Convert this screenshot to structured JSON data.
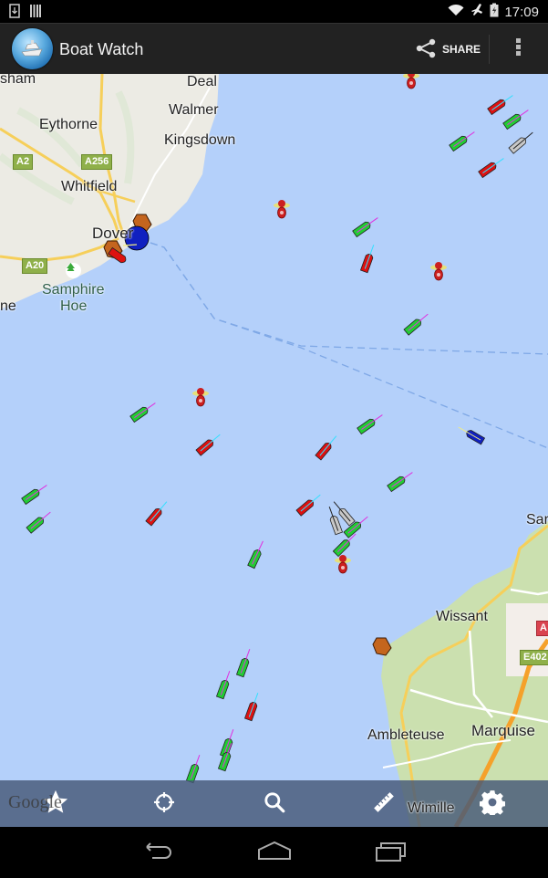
{
  "status_bar": {
    "left_icons": [
      "download-icon",
      "barcode-icon"
    ],
    "right_icons": [
      "wifi-icon",
      "airplane-mode-icon",
      "battery-charging-icon"
    ],
    "time": "17:09"
  },
  "action_bar": {
    "app_icon": "cruise-ship-logo-icon",
    "title": "Boat Watch",
    "share_label": "SHARE",
    "share_icon": "share-icon",
    "overflow_icon": "overflow-menu-icon"
  },
  "map": {
    "places": [
      {
        "name": "sham"
      },
      {
        "name": "Deal"
      },
      {
        "name": "Walmer"
      },
      {
        "name": "Eythorne"
      },
      {
        "name": "Kingsdown"
      },
      {
        "name": "Whitfield"
      },
      {
        "name": "Dover"
      },
      {
        "name": "Samphire"
      },
      {
        "name": "Hoe"
      },
      {
        "name": "ne"
      },
      {
        "name": "Sar"
      },
      {
        "name": "Wissant"
      },
      {
        "name": "Ambleteuse"
      },
      {
        "name": "Marquise"
      },
      {
        "name": "Wimille"
      }
    ],
    "road_labels": [
      "A2",
      "A256",
      "A20",
      "A",
      "E402"
    ],
    "poi_icon": "park-tree-icon",
    "vessel_legend": {
      "green": "#22cc33",
      "red": "#dd1111",
      "grey": "#c8c8c8",
      "blue": "#1020c0",
      "port": "#c4651e",
      "buoy": "#cc1f1f"
    },
    "attribution": "Google"
  },
  "bottom_toolbar": {
    "buttons": [
      {
        "name": "favorites",
        "icon": "star-icon"
      },
      {
        "name": "my-location",
        "icon": "crosshair-icon"
      },
      {
        "name": "search",
        "icon": "search-icon"
      },
      {
        "name": "measure",
        "icon": "ruler-icon"
      },
      {
        "name": "settings",
        "icon": "gear-icon"
      }
    ]
  },
  "nav_bar": {
    "buttons": [
      "back-icon",
      "home-icon",
      "recent-apps-icon"
    ]
  }
}
